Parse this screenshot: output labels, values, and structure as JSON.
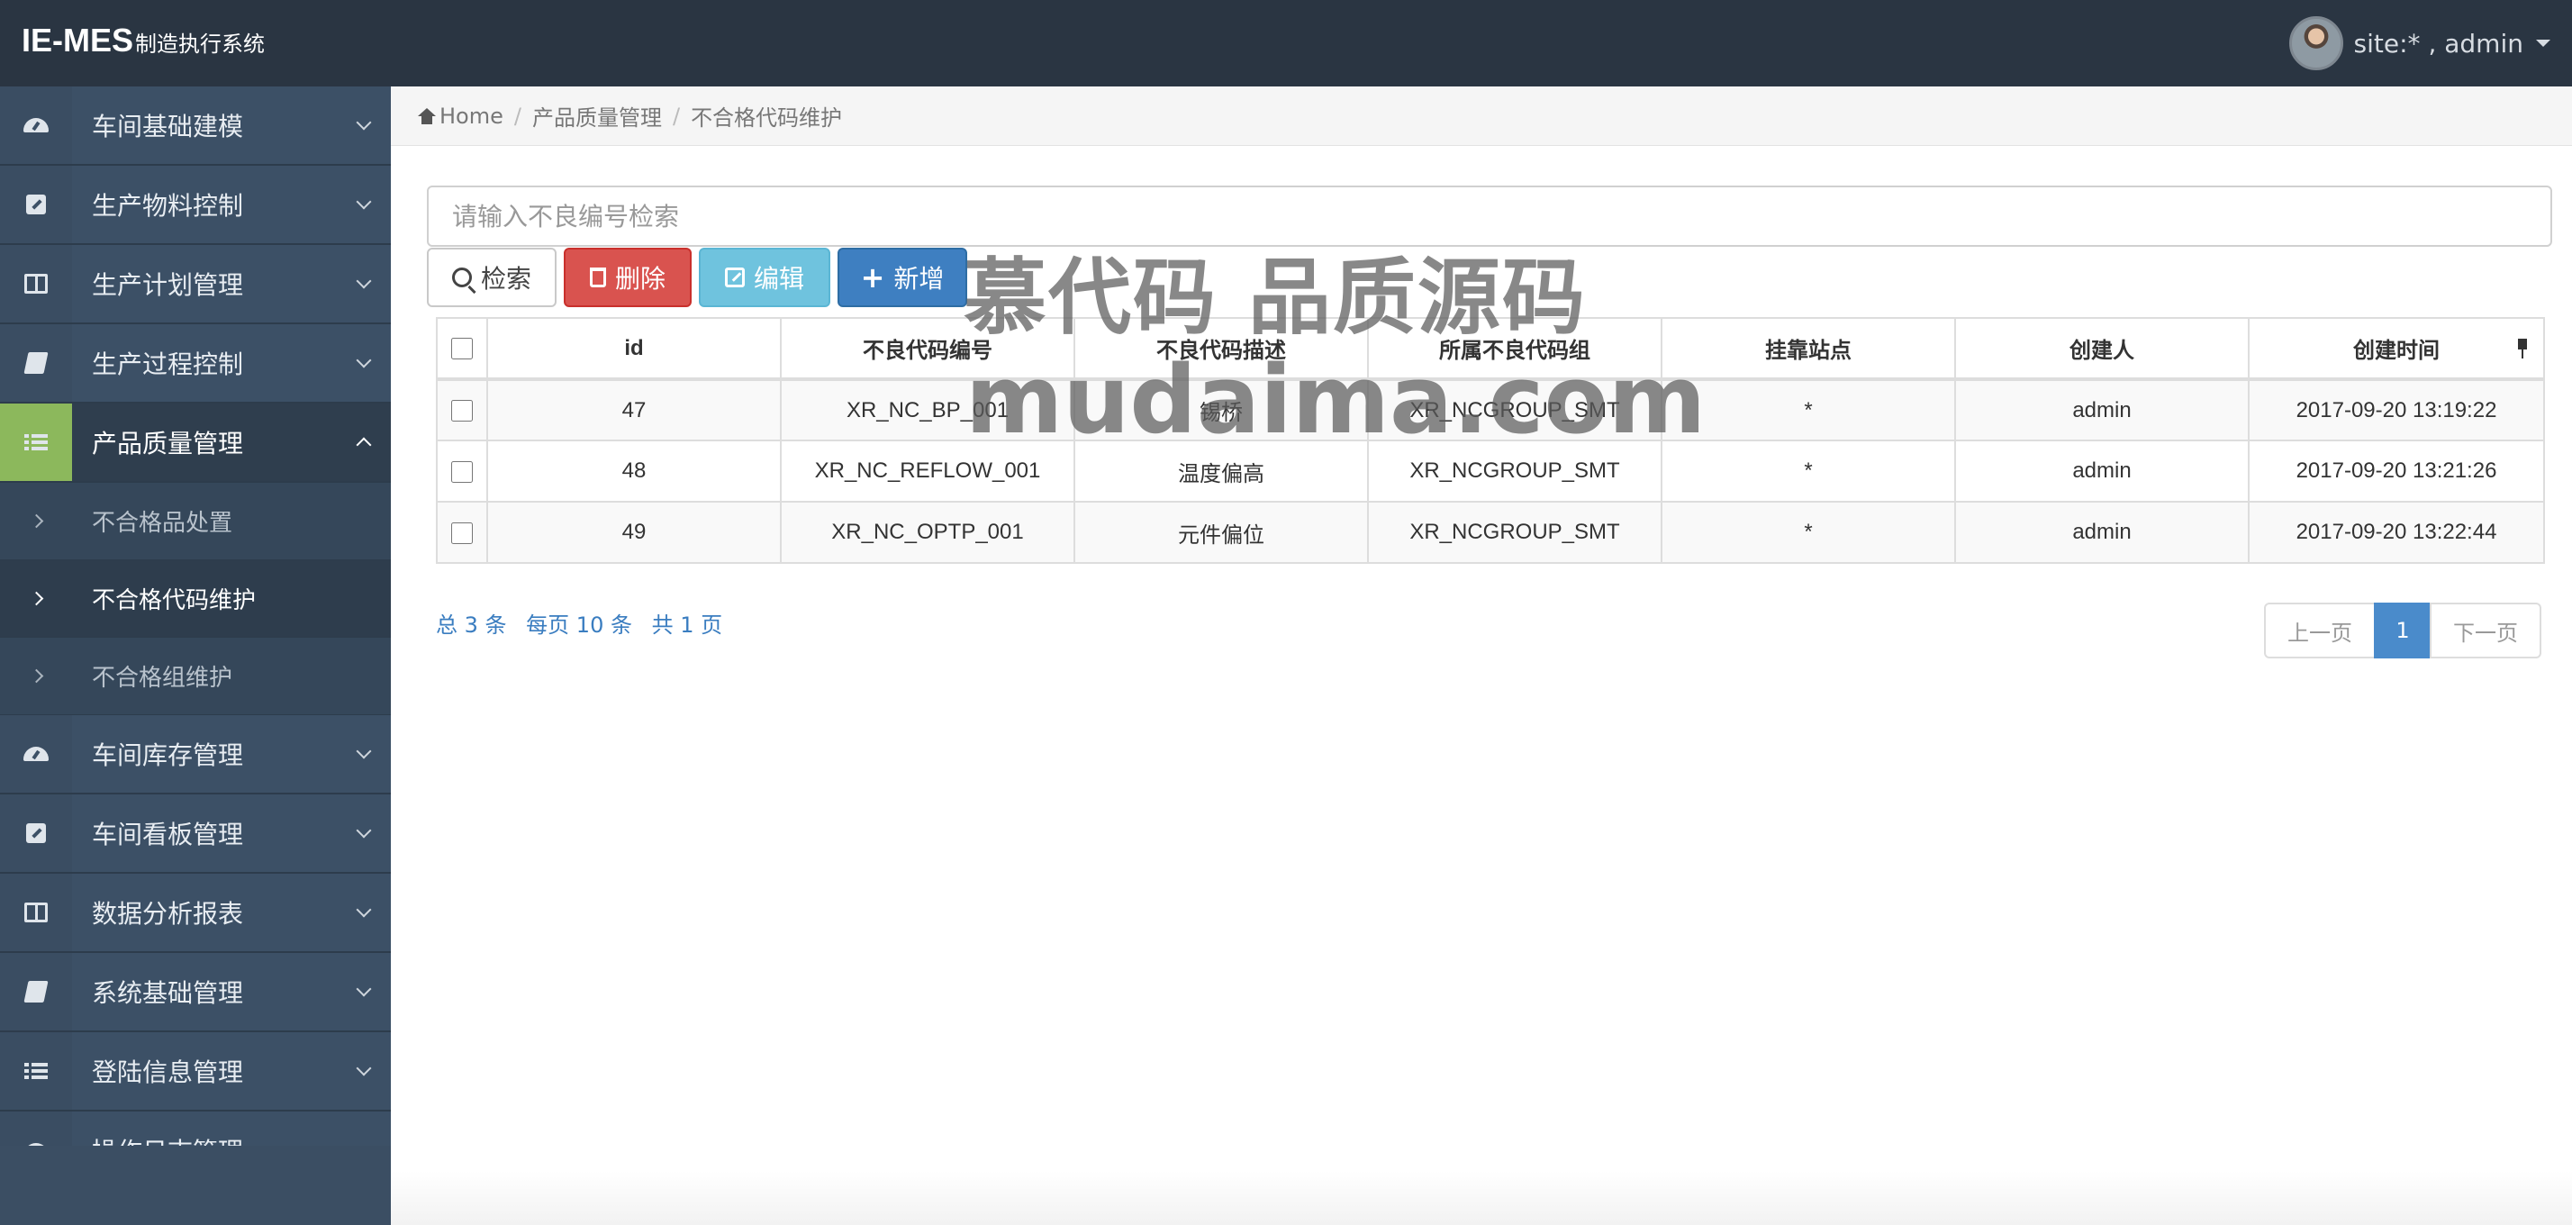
{
  "header": {
    "brand_main": "IE-MES",
    "brand_sub": "制造执行系统",
    "user_text": "site:* , admin"
  },
  "sidebar": {
    "items_top": [
      {
        "label": "车间基础建模",
        "icon": "dashboard-icon"
      },
      {
        "label": "生产物料控制",
        "icon": "edit-icon"
      },
      {
        "label": "生产计划管理",
        "icon": "columns-icon"
      },
      {
        "label": "生产过程控制",
        "icon": "book-icon"
      },
      {
        "label": "产品质量管理",
        "icon": "list-icon",
        "active": true
      }
    ],
    "sub_items": [
      {
        "label": "不合格品处置"
      },
      {
        "label": "不合格代码维护",
        "active": true
      },
      {
        "label": "不合格组维护"
      }
    ],
    "items_bottom": [
      {
        "label": "车间库存管理",
        "icon": "dashboard-icon"
      },
      {
        "label": "车间看板管理",
        "icon": "edit-icon"
      },
      {
        "label": "数据分析报表",
        "icon": "columns-icon"
      },
      {
        "label": "系统基础管理",
        "icon": "book-icon"
      },
      {
        "label": "登陆信息管理",
        "icon": "list-icon"
      },
      {
        "label": "操作日志管理",
        "icon": "dashboard-icon"
      }
    ]
  },
  "breadcrumb": {
    "home": "Home",
    "level1": "产品质量管理",
    "level2": "不合格代码维护"
  },
  "search": {
    "placeholder": "请输入不良编号检索",
    "value": ""
  },
  "toolbar": {
    "search_label": "检索",
    "delete_label": "删除",
    "edit_label": "编辑",
    "add_label": "新增"
  },
  "table": {
    "headers": [
      "id",
      "不良代码编号",
      "不良代码描述",
      "所属不良代码组",
      "挂靠站点",
      "创建人",
      "创建时间"
    ],
    "rows": [
      [
        "47",
        "XR_NC_BP_001",
        "锡桥",
        "XR_NCGROUP_SMT",
        "*",
        "admin",
        "2017-09-20 13:19:22"
      ],
      [
        "48",
        "XR_NC_REFLOW_001",
        "温度偏高",
        "XR_NCGROUP_SMT",
        "*",
        "admin",
        "2017-09-20 13:21:26"
      ],
      [
        "49",
        "XR_NC_OPTP_001",
        "元件偏位",
        "XR_NCGROUP_SMT",
        "*",
        "admin",
        "2017-09-20 13:22:44"
      ]
    ]
  },
  "page_info": {
    "total": "总 3 条",
    "per_page": "每页 10 条",
    "pages": "共 1 页"
  },
  "pagination": {
    "prev": "上一页",
    "current": "1",
    "next": "下一页"
  },
  "watermark": {
    "line1": "慕代码 品质源码",
    "line2": "mudaima.com"
  },
  "colors": {
    "header_bg": "#2a3542",
    "sidebar_bg": "#35475a",
    "active_accent": "#8cb85c",
    "danger": "#d9534f",
    "info": "#6fc3de",
    "primary": "#3e7fc1",
    "link": "#3a7dc0"
  }
}
